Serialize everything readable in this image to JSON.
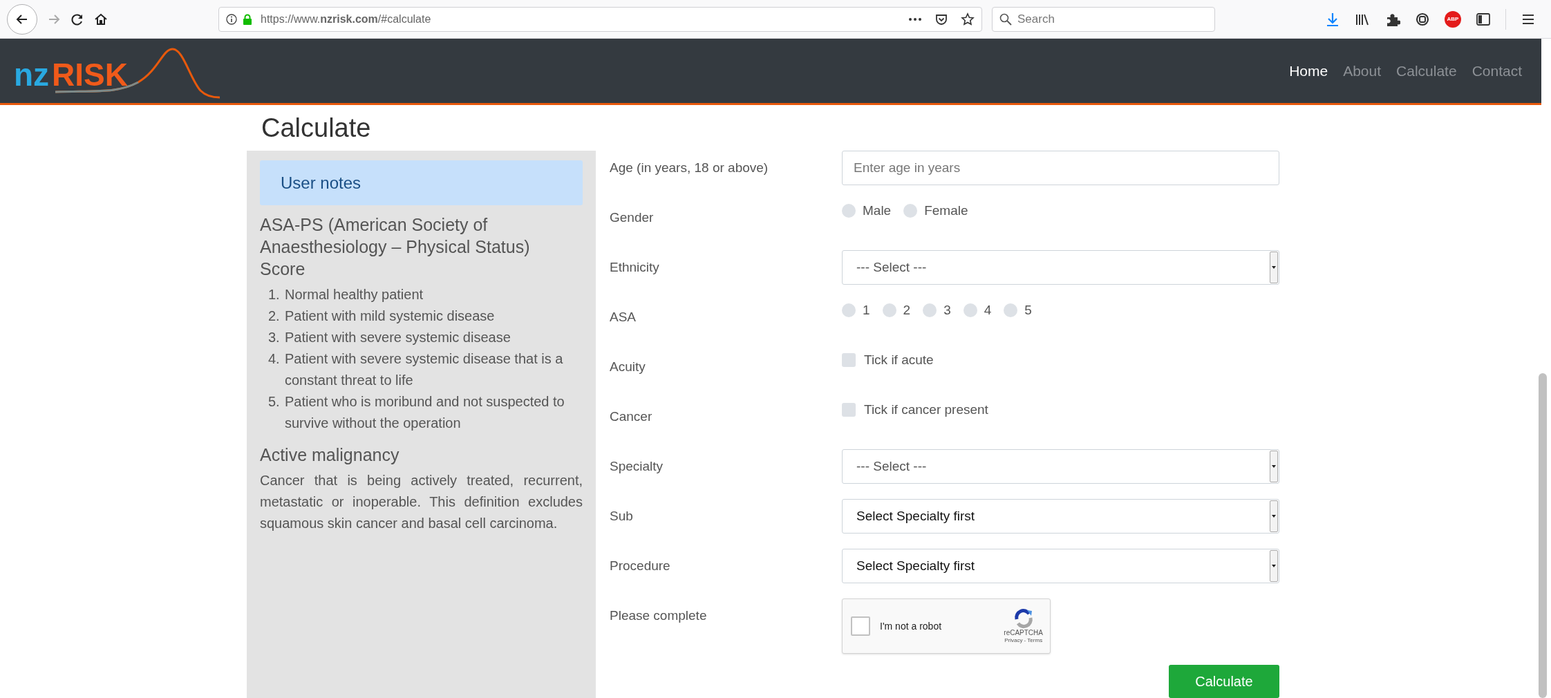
{
  "browser": {
    "url": "https://www.**nzrisk.com**/#calculate",
    "search": {
      "placeholder": "Search"
    },
    "extension_badge": "ABP"
  },
  "header": {
    "logo": {
      "part1": "nz",
      "part2": "RISK"
    },
    "nav": [
      {
        "label": "Home",
        "selected": true
      },
      {
        "label": "About",
        "selected": false
      },
      {
        "label": "Calculate",
        "selected": false
      },
      {
        "label": "Contact",
        "selected": false
      }
    ]
  },
  "page_title": "Calculate",
  "notes": {
    "heading": "User notes",
    "asa_title": "ASA-PS (American Society of Anaesthesiology – Physical Status) Score",
    "asa_items": [
      {
        "number": "1.",
        "text": "Normal healthy patient"
      },
      {
        "number": "2.",
        "text": "Patient with mild systemic disease"
      },
      {
        "number": "3.",
        "text": "Patient with severe systemic disease"
      },
      {
        "number": "4.",
        "text": "Patient with severe systemic disease that is a constant threat to life"
      },
      {
        "number": "5.",
        "text": "Patient who is moribund and not suspected to survive without the operation"
      }
    ],
    "malignancy_title": "Active malignancy",
    "malignancy_text": "Cancer that is being actively treated, recurrent, metastatic or inoperable. This definition excludes squamous skin cancer and basal cell carcinoma."
  },
  "form": {
    "rows": [
      {
        "kind": "text",
        "label": "Age (in years, 18 or above)",
        "placeholder": "Enter age in years"
      },
      {
        "kind": "radio",
        "label": "Gender",
        "options": [
          {
            "label": "Male",
            "checked": false
          },
          {
            "label": "Female",
            "checked": false
          }
        ]
      },
      {
        "kind": "select",
        "label": "Ethnicity",
        "value": "--- Select ---",
        "muted": true
      },
      {
        "kind": "radio",
        "label": "ASA",
        "options": [
          {
            "label": "1",
            "checked": false
          },
          {
            "label": "2",
            "checked": false
          },
          {
            "label": "3",
            "checked": false
          },
          {
            "label": "4",
            "checked": false
          },
          {
            "label": "5",
            "checked": false
          }
        ]
      },
      {
        "kind": "checkbox",
        "label": "Acuity",
        "text": "Tick if acute",
        "checked": false
      },
      {
        "kind": "checkbox",
        "label": "Cancer",
        "text": "Tick if cancer present",
        "checked": false
      },
      {
        "kind": "select",
        "label": "Specialty",
        "value": "--- Select ---",
        "muted": true
      },
      {
        "kind": "select",
        "label": "Sub",
        "value": "Select Specialty first",
        "muted": false
      },
      {
        "kind": "select",
        "label": "Procedure",
        "value": "Select Specialty first",
        "muted": false
      },
      {
        "kind": "captcha",
        "label": "Please complete",
        "text": "I'm not a robot",
        "checked": false,
        "brand": "reCAPTCHA",
        "links": "Privacy - Terms"
      }
    ],
    "submit": "Calculate"
  }
}
